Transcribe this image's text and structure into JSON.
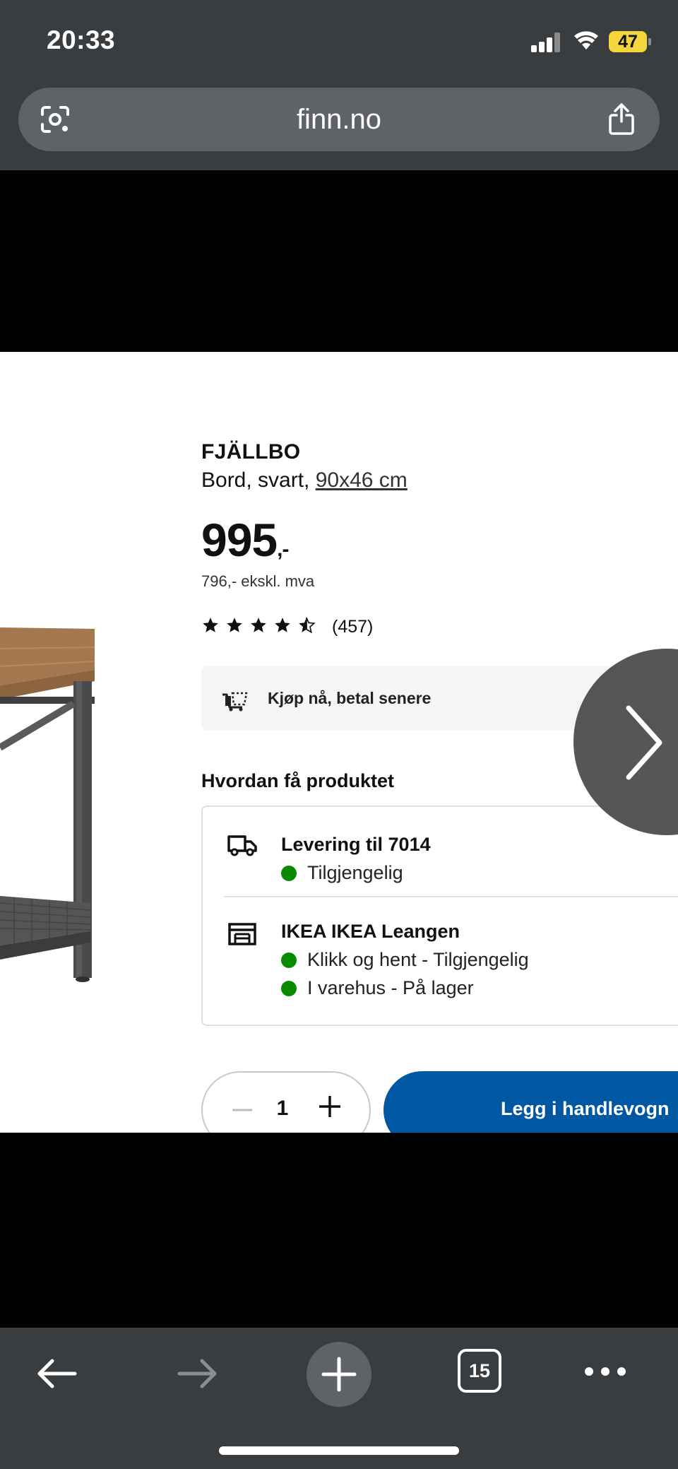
{
  "status_bar": {
    "time": "20:33",
    "battery": "47",
    "battery_color": "#f4d53b"
  },
  "address_bar": {
    "url": "finn.no",
    "left_icon": "camera-lens-icon",
    "right_icon": "share-icon"
  },
  "product": {
    "brand": "FJÄLLBO",
    "description": "Bord, svart, ",
    "size": "90x46 cm",
    "price": "995",
    "price_suffix": ",-",
    "price_ex_vat": "796,- ekskl. mva",
    "rating_value": 4.5,
    "rating_max": 5,
    "review_count": "(457)"
  },
  "bnpl": {
    "label": "Kjøp nå, betal senere",
    "icon": "pay-later-icon"
  },
  "how_to_get": {
    "title": "Hvordan få produktet",
    "delivery": {
      "title": "Levering til 7014",
      "status": "Tilgjengelig",
      "icon": "truck-icon"
    },
    "store": {
      "title": "IKEA IKEA Leangen",
      "status_1": "Klikk og hent - Tilgjengelig",
      "status_2": "I varehus - På lager",
      "icon": "store-icon"
    },
    "status_color": "#0a8a00"
  },
  "purchase": {
    "quantity": "1",
    "add_to_cart": "Legg i handlevogn",
    "button_color": "#0058a3"
  },
  "toolbar": {
    "tab_count": "15"
  }
}
